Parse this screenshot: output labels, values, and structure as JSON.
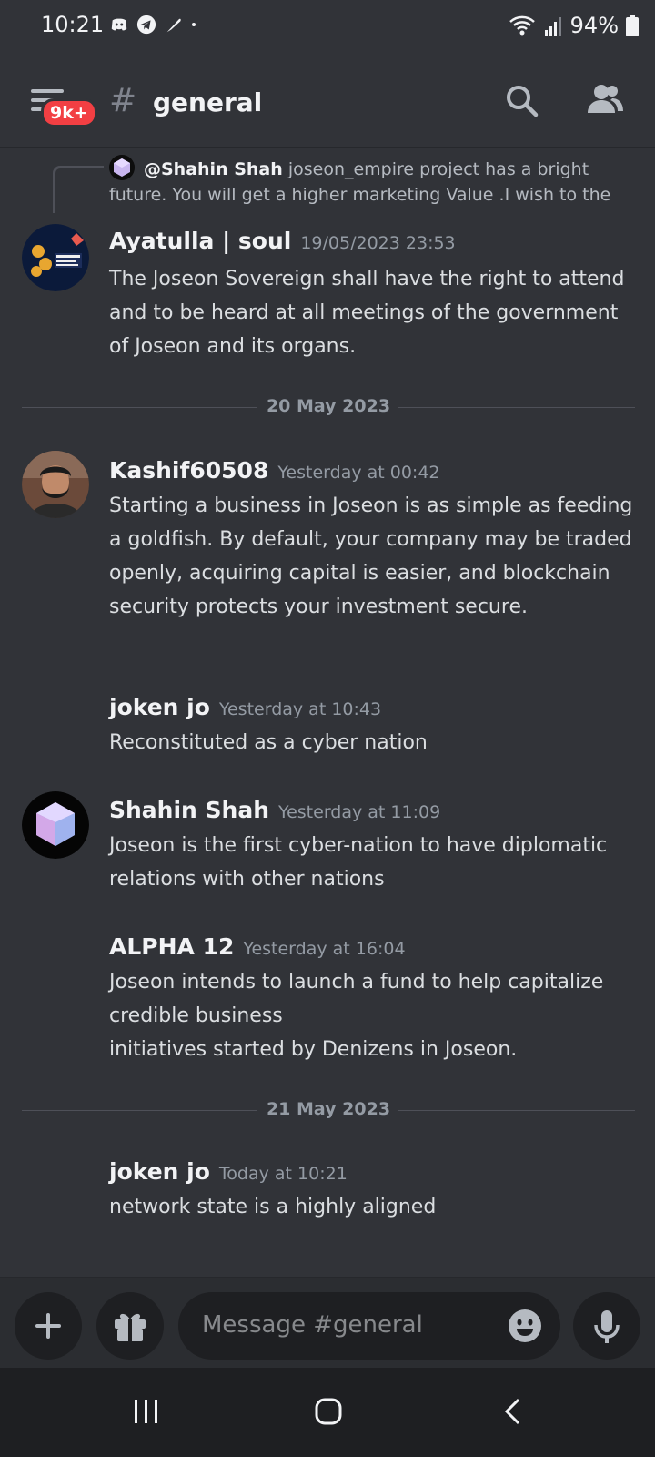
{
  "status_bar": {
    "time": "10:21",
    "battery": "94%"
  },
  "header": {
    "badge": "9k+",
    "hash": "#",
    "channel": "general"
  },
  "reply": {
    "author": "@Shahin Shah",
    "text": "joseon_empire project has a bright future. You will get a higher marketing Value .I wish to the"
  },
  "messages": [
    {
      "author": "Ayatulla | soul",
      "time": "19/05/2023 23:53",
      "text": "The Joseon Sovereign shall have the right to attend and to be heard at all meetings of the government of Joseon and its organs."
    },
    {
      "author": "Kashif60508",
      "time": "Yesterday at 00:42",
      "text": "Starting a business in Joseon is as simple as feeding a goldfish. By default, your company may be traded openly, acquiring capital is easier, and blockchain security protects your investment secure."
    },
    {
      "author": "joken  jo",
      "time": "Yesterday at 10:43",
      "text": "Reconstituted as a cyber nation"
    },
    {
      "author": "Shahin Shah",
      "time": "Yesterday at 11:09",
      "text": "Joseon is the first cyber-nation to have diplomatic relations with other nations"
    },
    {
      "author": "ALPHA 12",
      "time": "Yesterday at 16:04",
      "text_line1": "Joseon intends to launch a fund to help capitalize credible business",
      "text_line2": "initiatives started by Denizens in Joseon."
    },
    {
      "author": "joken  jo",
      "time": "Today at 10:21",
      "text": "network state is a highly aligned"
    }
  ],
  "dividers": [
    "20 May 2023",
    "21 May 2023"
  ],
  "composer": {
    "placeholder": "Message #general"
  },
  "colors": {
    "background": "#313338",
    "badge": "#f23f43",
    "text": "#dbdee1",
    "muted": "#949ba4"
  }
}
